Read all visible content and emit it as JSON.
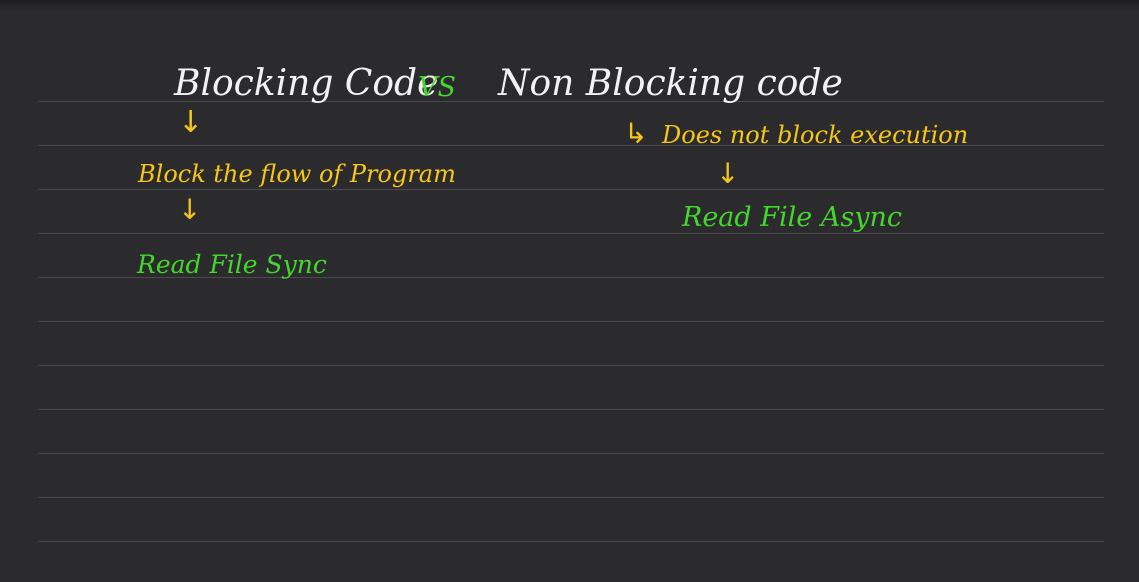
{
  "heading": {
    "left": "Blocking Code",
    "vs": "VS",
    "right": "Non Blocking code"
  },
  "blocking": {
    "arrow1": "↓",
    "description": "Block the flow of Program",
    "arrow2": "↓",
    "example": "Read File Sync"
  },
  "non_blocking": {
    "hook_arrow": "↳",
    "description": "Does not block execution",
    "arrow": "↓",
    "example": "Read File Async"
  },
  "colors": {
    "background": "#2b2b2d",
    "rule": "#4a4a4d",
    "white_ink": "#f2f2f2",
    "yellow_ink": "#f5c518",
    "green_ink": "#43d62b"
  }
}
